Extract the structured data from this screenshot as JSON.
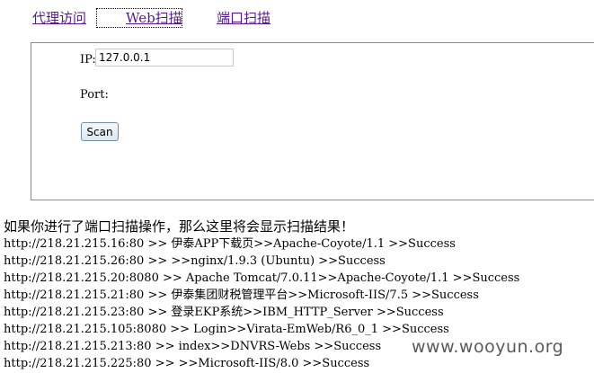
{
  "nav": {
    "tabs": [
      {
        "label": "代理访问"
      },
      {
        "label": "Web扫描"
      },
      {
        "label": "端口扫描"
      }
    ]
  },
  "form": {
    "ip_label": "IP:",
    "ip_value": "127.0.0.1",
    "port_label": "Port:",
    "scan_label": "Scan"
  },
  "results": {
    "intro": "如果你进行了端口扫描操作，那么这里将会显示扫描结果！",
    "items": [
      "http://218.21.215.16:80 >> 伊泰APP下载页>>Apache-Coyote/1.1 >>Success",
      "http://218.21.215.26:80 >> >>nginx/1.9.3 (Ubuntu) >>Success",
      "http://218.21.215.20:8080 >> Apache Tomcat/7.0.11>>Apache-Coyote/1.1 >>Success",
      "http://218.21.215.21:80 >> 伊泰集团财税管理平台>>Microsoft-IIS/7.5 >>Success",
      "http://218.21.215.23:80 >> 登录EKP系统>>IBM_HTTP_Server >>Success",
      "http://218.21.215.105:8080 >> Login>>Virata-EmWeb/R6_0_1 >>Success",
      "http://218.21.215.213:80 >> index>>DNVRS-Webs >>Success",
      "http://218.21.215.225:80 >> >>Microsoft-IIS/8.0 >>Success"
    ]
  },
  "watermark": "www.wooyun.org"
}
